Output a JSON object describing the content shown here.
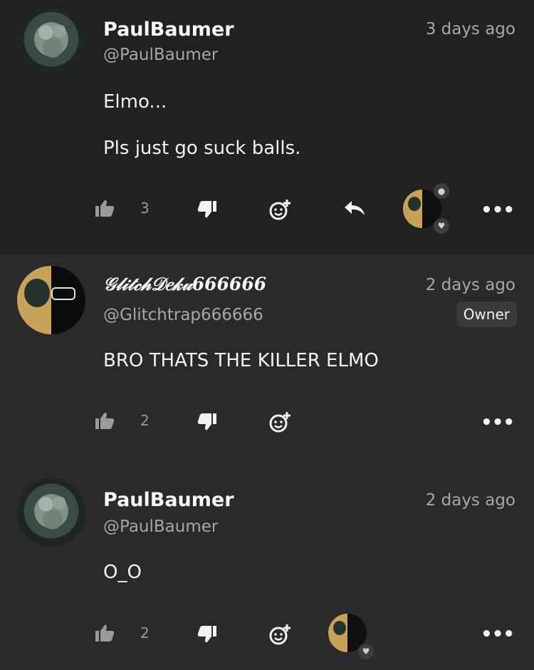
{
  "comments": [
    {
      "author": "PaulBaumer",
      "handle": "@PaulBaumer",
      "time": "3 days ago",
      "lines": [
        "Elmo...",
        "Pls just go suck balls."
      ],
      "likes": "3",
      "avatar_icon": "zombie-avatar"
    },
    {
      "author": "𝒢𝓁𝒾𝓉𝒸𝒽𝒟𝑒𝓀𝓊666666",
      "handle": "@Glitchtrap666666",
      "time": "2 days ago",
      "badge": "Owner",
      "lines": [
        "BRO THATS THE KILLER ELMO"
      ],
      "likes": "2",
      "avatar_icon": "deku-avatar"
    },
    {
      "author": "PaulBaumer",
      "handle": "@PaulBaumer",
      "time": "2 days ago",
      "lines": [
        "O_O"
      ],
      "likes": "2",
      "avatar_icon": "zombie-avatar"
    }
  ],
  "more_label": "•••",
  "colors": {
    "background": "#2a2a2a",
    "highlight": "#212121",
    "text": "#f2f2f2",
    "muted": "#a7a7a7"
  }
}
